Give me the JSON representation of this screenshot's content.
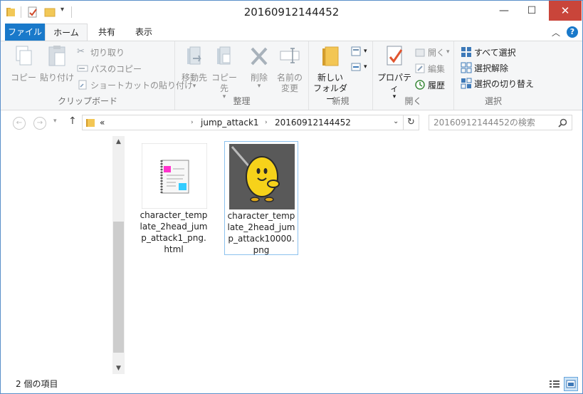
{
  "window": {
    "title": "20160912144452"
  },
  "tabs": [
    {
      "label": "ファイル"
    },
    {
      "label": "ホーム"
    },
    {
      "label": "共有"
    },
    {
      "label": "表示"
    }
  ],
  "ribbon": {
    "clipboard": {
      "label": "クリップボード",
      "copy": "コピー",
      "paste": "貼り付け",
      "cut": "切り取り",
      "copy_path": "パスのコピー",
      "paste_shortcut": "ショートカットの貼り付け"
    },
    "organize": {
      "label": "整理",
      "move_to": "移動先",
      "copy_to": "コピー先",
      "delete": "削除",
      "rename_line1": "名前の",
      "rename_line2": "変更"
    },
    "new": {
      "label": "新規",
      "new_folder_line1": "新しい",
      "new_folder_line2": "フォルダー"
    },
    "open": {
      "label": "開く",
      "properties": "プロパティ",
      "open": "開く",
      "edit": "編集",
      "history": "履歴"
    },
    "select": {
      "label": "選択",
      "select_all": "すべて選択",
      "select_none": "選択解除",
      "invert_selection": "選択の切り替え"
    }
  },
  "address": {
    "overflow": "«",
    "crumbs": [
      "jump_attack1",
      "20160912144452"
    ]
  },
  "search": {
    "placeholder": "20160912144452の検索"
  },
  "files": [
    {
      "name": "character_template_2head_jump_attack1_png.html",
      "type": "html"
    },
    {
      "name": "character_template_2head_jump_attack10000.png",
      "type": "png"
    }
  ],
  "status": {
    "item_count": "2 個の項目"
  },
  "colors": {
    "accent": "#1979ca",
    "close": "#c9453a",
    "selection_border": "#8dc2ee"
  }
}
